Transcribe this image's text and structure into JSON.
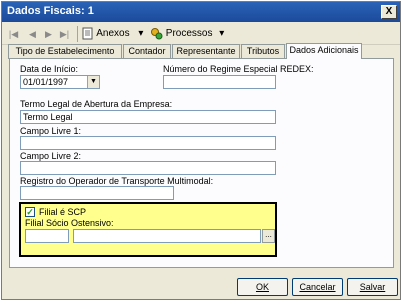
{
  "window": {
    "title": "Dados Fiscais: 1",
    "close_label": "X"
  },
  "toolbar": {
    "nav_first": "|◀",
    "nav_prev": "◀",
    "nav_next": "▶",
    "nav_last": "▶|",
    "anexos_label": "Anexos",
    "processos_label": "Processos",
    "dropdown_arrow": "▾"
  },
  "tabs": [
    {
      "label": "Tipo de Estabelecimento"
    },
    {
      "label": "Contador"
    },
    {
      "label": "Representante"
    },
    {
      "label": "Tributos"
    },
    {
      "label": "Dados Adicionais"
    }
  ],
  "form": {
    "data_inicio_label": "Data de Início:",
    "data_inicio_value": "01/01/1997",
    "regime_label": "Número do Regime Especial REDEX:",
    "regime_value": "",
    "termo_label": "Termo Legal de Abertura da Empresa:",
    "termo_value": "Termo Legal",
    "livre1_label": "Campo Livre 1:",
    "livre1_value": "",
    "livre2_label": "Campo Livre 2:",
    "livre2_value": "",
    "registro_label": "Registro do Operador de Transporte Multimodal:",
    "registro_value": "",
    "filial_scp_label": "Filial é SCP",
    "filial_scp_checked": true,
    "check_mark": "✓",
    "socio_label": "Filial Sócio Ostensivo:",
    "socio_code": "",
    "socio_name": "",
    "ellipsis": "..."
  },
  "buttons": {
    "ok": "OK",
    "cancelar": "Cancelar",
    "salvar": "Salvar"
  },
  "colors": {
    "title_bar": "#2a63b8",
    "highlight": "#ffff8e",
    "window_bg": "#ece9d8"
  }
}
